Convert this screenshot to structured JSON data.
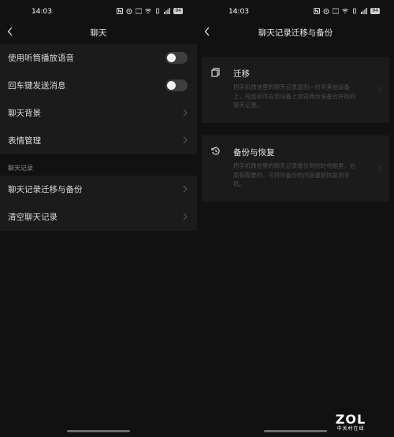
{
  "status": {
    "time": "14:03",
    "battery": "94"
  },
  "chat_settings": {
    "title": "聊天",
    "toggle_rows": [
      {
        "label": "使用听筒播放语音",
        "on": false
      },
      {
        "label": "回车键发送消息",
        "on": false
      }
    ],
    "link_rows": [
      {
        "label": "聊天背景"
      },
      {
        "label": "表情管理"
      }
    ],
    "section_label": "聊天记录",
    "record_rows": [
      {
        "label": "聊天记录迁移与备份"
      },
      {
        "label": "清空聊天记录"
      }
    ]
  },
  "migration": {
    "title": "聊天记录迁移与备份",
    "cards": [
      {
        "icon": "migrate-icon",
        "title": "迁移",
        "desc": "把手机微信里的聊天记录复制一份到其他设备上，完成后可在该设备上浏览两台设备合并后的聊天记录。"
      },
      {
        "icon": "backup-restore-icon",
        "title": "备份与恢复",
        "desc": "把手机微信里的聊天记录备份到你的电脑里，后面有需要时，可将所备份的内容重新恢复到手机。"
      }
    ]
  },
  "watermark": {
    "logo": "ZOL",
    "sub": "中关村在线"
  },
  "colors": {
    "background": "#111111",
    "card": "#1b1b1b",
    "toggle_track": "#3e3e3e"
  }
}
